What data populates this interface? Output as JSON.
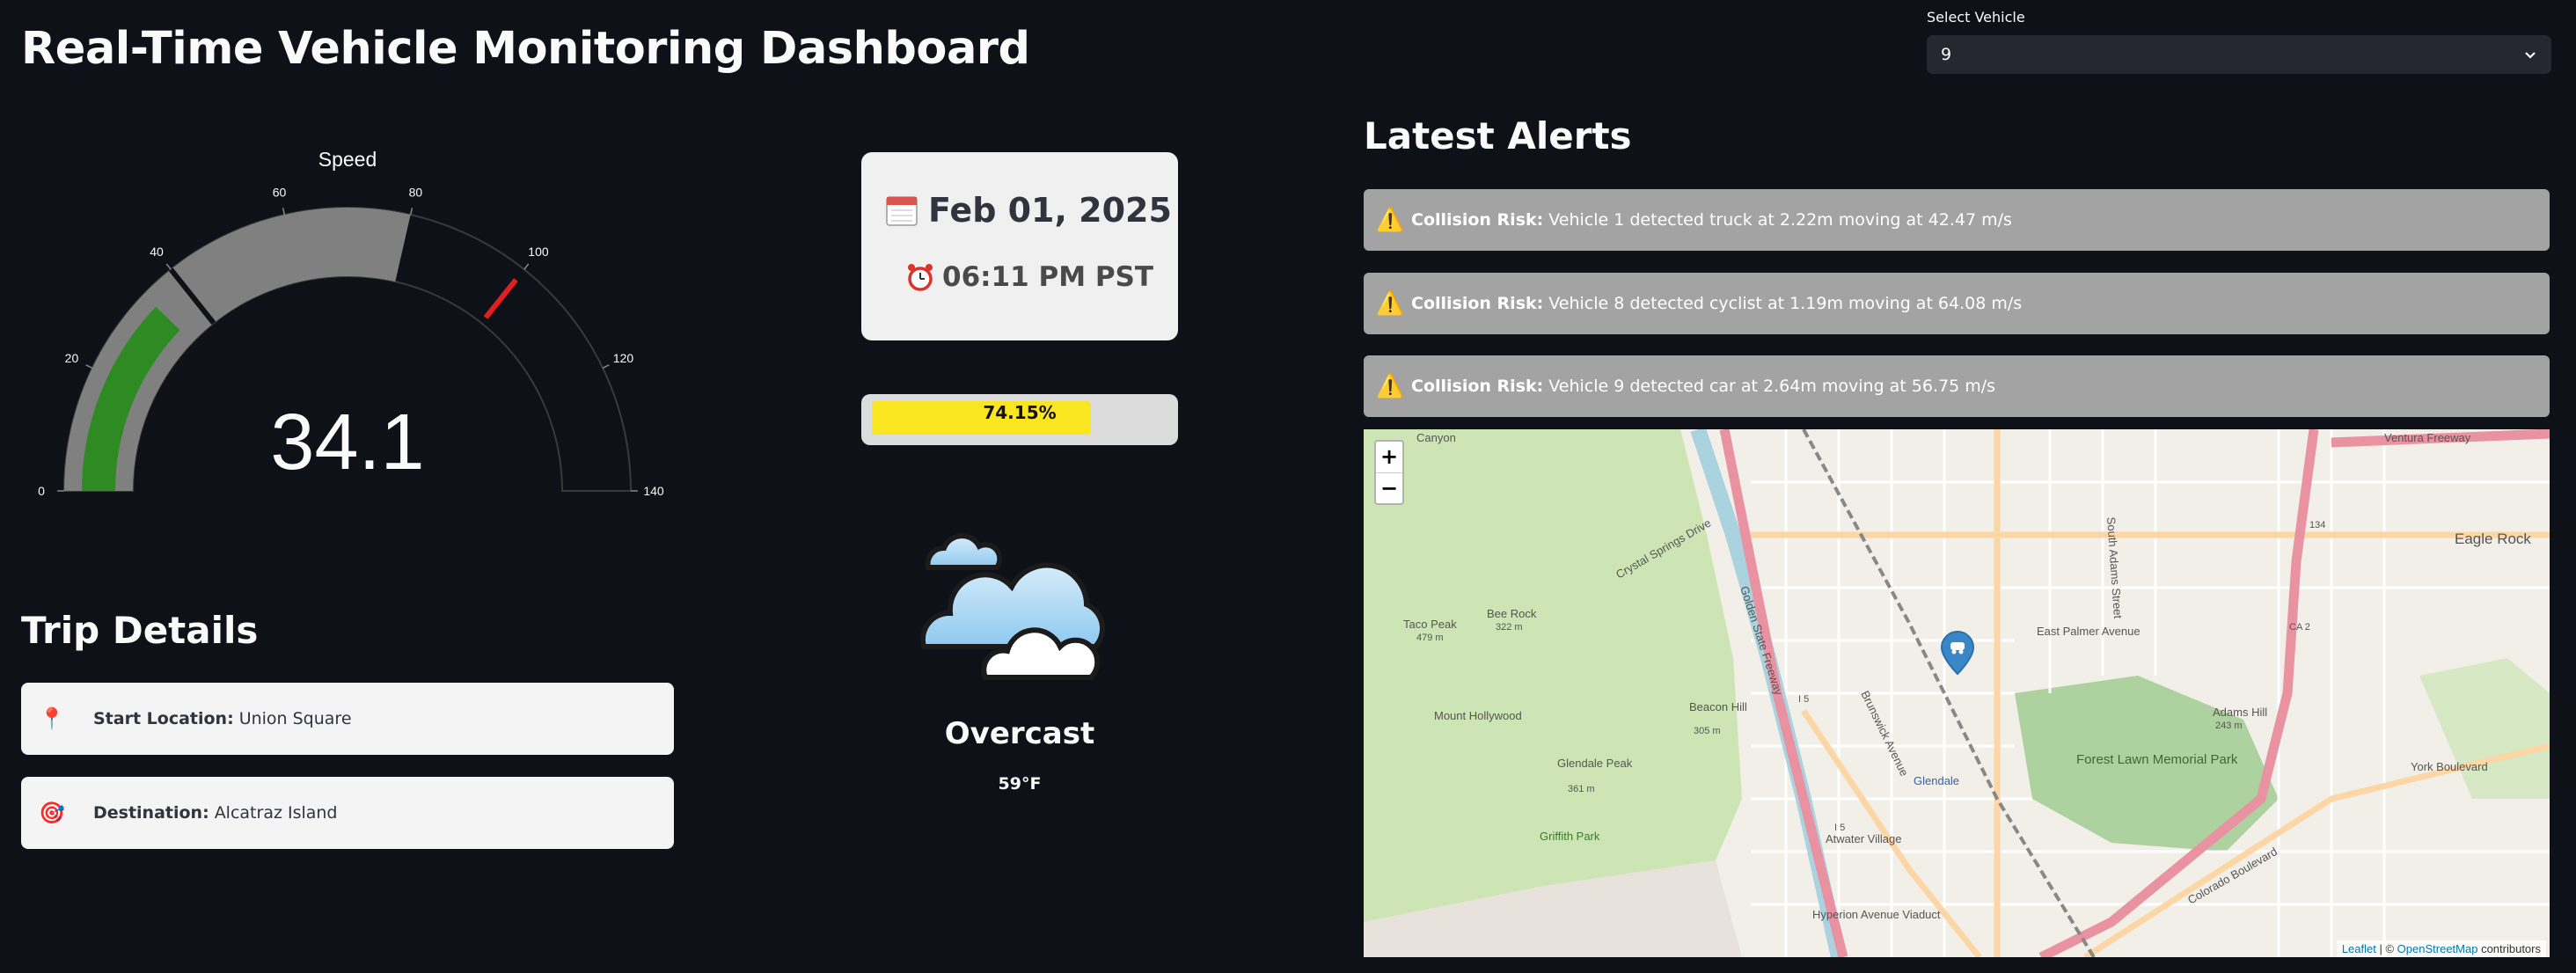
{
  "page": {
    "title": "Real-Time Vehicle Monitoring Dashboard"
  },
  "vehicle_select": {
    "label": "Select Vehicle",
    "value": "9",
    "icon": "chevron-down-icon"
  },
  "speed_gauge": {
    "title": "Speed",
    "value": "34.1",
    "min": 0,
    "max": 140,
    "ticks": [
      "0",
      "20",
      "40",
      "60",
      "80",
      "100",
      "120",
      "140"
    ],
    "green_band": [
      0,
      40
    ],
    "gray_band": [
      40,
      80
    ],
    "threshold": 100,
    "colors": {
      "fill": "#2e8b23",
      "band": "#808080",
      "threshold": "#e02020"
    }
  },
  "datetime": {
    "date": "Feb 01, 2025",
    "time": "06:11 PM PST",
    "date_icon": "calendar-icon",
    "time_icon": "alarm-clock-icon"
  },
  "progress": {
    "label": "74.15%",
    "value": 0.7415,
    "color": "#ffe600"
  },
  "weather": {
    "condition": "Overcast",
    "temperature": "59°F",
    "icon": "clouds-icon"
  },
  "trip": {
    "title": "Trip Details",
    "start": {
      "label": "Start Location:",
      "value": "Union Square",
      "icon": "pushpin-icon"
    },
    "destination": {
      "label": "Destination:",
      "value": "Alcatraz Island",
      "icon": "target-icon"
    }
  },
  "alerts": {
    "title": "Latest Alerts",
    "items": [
      {
        "label": "Collision Risk:",
        "text": "Vehicle 1 detected truck at 2.22m moving at 42.47 m/s",
        "icon": "warning-icon"
      },
      {
        "label": "Collision Risk:",
        "text": "Vehicle 8 detected cyclist at 1.19m moving at 64.08 m/s",
        "icon": "warning-icon"
      },
      {
        "label": "Collision Risk:",
        "text": "Vehicle 9 detected car at 2.64m moving at 56.75 m/s",
        "icon": "warning-icon"
      }
    ]
  },
  "map": {
    "zoom_in": "+",
    "zoom_out": "−",
    "attribution": {
      "leaflet": "Leaflet",
      "sep": " | © ",
      "osm": "OpenStreetMap",
      "suffix": " contributors"
    },
    "labels": {
      "ventura_freeway": "Ventura Freeway",
      "eagle_rock": "Eagle Rock",
      "east_palmer": "East Palmer Avenue",
      "taco_peak": "Taco Peak",
      "taco_peak_elev": "479 m",
      "bee_rock": "Bee Rock",
      "bee_rock_elev": "322 m",
      "mount_hollywood": "Mount Hollywood",
      "beacon_hill": "Beacon Hill",
      "beacon_hill_elev": "305 m",
      "glendale_peak": "Glendale Peak",
      "glendale_peak_elev": "361 m",
      "griffith_park": "Griffith Park",
      "forest_lawn": "Forest Lawn Memorial Park",
      "adams_hill": "Adams Hill",
      "adams_hill_elev": "243 m",
      "glendale": "Glendale",
      "atwater_village": "Atwater Village",
      "crystal_springs": "Crystal Springs Drive",
      "ca2": "CA 2",
      "york_blvd": "York Boulevard",
      "colorado_blvd": "Colorado Boulevard",
      "golden_state": "Golden State Freeway",
      "hyperion": "Hyperion Avenue Viaduct",
      "canyon": "Canyon",
      "brunswick": "Brunswick Avenue",
      "south_adams": "South Adams Street",
      "i5": "I 5",
      "i5b": "I 5",
      "route_134": "134"
    },
    "marker_icon": "car-marker-icon",
    "colors": {
      "park": "#cde5b4",
      "water": "#aad3df",
      "motorway": "#e892a2",
      "primary": "#fcd6a4"
    }
  }
}
